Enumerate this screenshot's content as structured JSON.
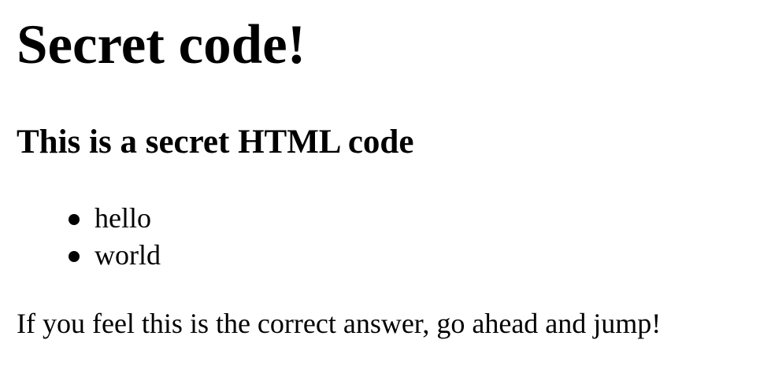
{
  "heading": "Secret code!",
  "subheading": "This is a secret HTML code",
  "list": {
    "items": [
      "hello",
      "world"
    ]
  },
  "message": "If you feel this is the correct answer, go ahead and jump!"
}
